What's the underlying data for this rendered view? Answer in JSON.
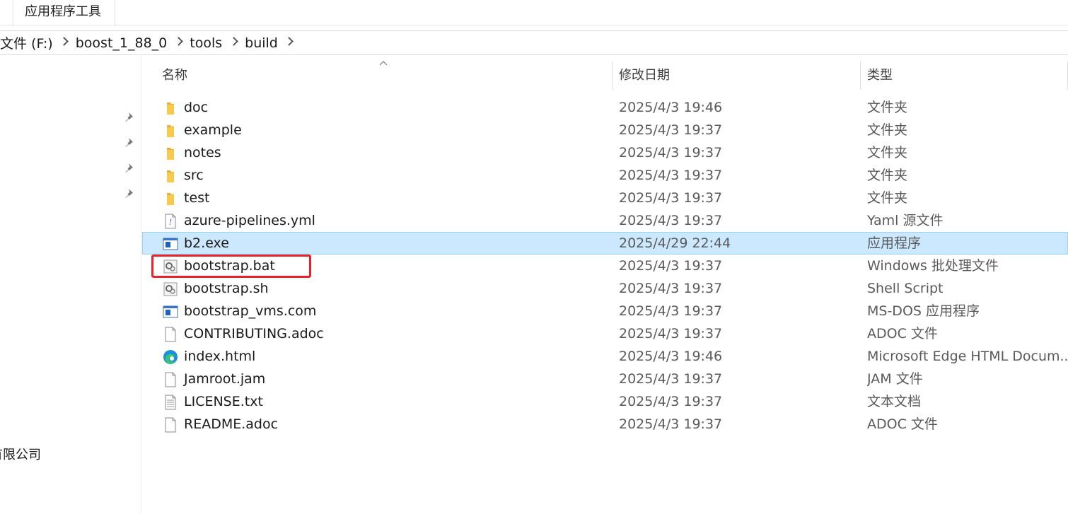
{
  "ribbon": {
    "tab_label": "应用程序工具"
  },
  "breadcrumb": [
    "文件 (F:)",
    "boost_1_88_0",
    "tools",
    "build"
  ],
  "navpane": {
    "company_label": "有限公司"
  },
  "columns": {
    "name": "名称",
    "date": "修改日期",
    "type": "类型"
  },
  "files": [
    {
      "name": "doc",
      "date": "2025/4/3 19:46",
      "type": "文件夹",
      "icon": "folder-icon"
    },
    {
      "name": "example",
      "date": "2025/4/3 19:37",
      "type": "文件夹",
      "icon": "folder-icon"
    },
    {
      "name": "notes",
      "date": "2025/4/3 19:37",
      "type": "文件夹",
      "icon": "folder-icon"
    },
    {
      "name": "src",
      "date": "2025/4/3 19:37",
      "type": "文件夹",
      "icon": "folder-icon"
    },
    {
      "name": "test",
      "date": "2025/4/3 19:37",
      "type": "文件夹",
      "icon": "folder-icon"
    },
    {
      "name": "azure-pipelines.yml",
      "date": "2025/4/3 19:37",
      "type": "Yaml 源文件",
      "icon": "yaml-file-icon"
    },
    {
      "name": "b2.exe",
      "date": "2025/4/29 22:44",
      "type": "应用程序",
      "icon": "exe-app-icon",
      "selected": true
    },
    {
      "name": "bootstrap.bat",
      "date": "2025/4/3 19:37",
      "type": "Windows 批处理文件",
      "icon": "gear-script-icon",
      "highlighted": true
    },
    {
      "name": "bootstrap.sh",
      "date": "2025/4/3 19:37",
      "type": "Shell Script",
      "icon": "gear-script-icon"
    },
    {
      "name": "bootstrap_vms.com",
      "date": "2025/4/3 19:37",
      "type": "MS-DOS 应用程序",
      "icon": "exe-app-icon"
    },
    {
      "name": "CONTRIBUTING.adoc",
      "date": "2025/4/3 19:37",
      "type": "ADOC 文件",
      "icon": "blank-file-icon"
    },
    {
      "name": "index.html",
      "date": "2025/4/3 19:46",
      "type": "Microsoft Edge HTML Docum...",
      "icon": "edge-browser-icon"
    },
    {
      "name": "Jamroot.jam",
      "date": "2025/4/3 19:37",
      "type": "JAM 文件",
      "icon": "blank-file-icon"
    },
    {
      "name": "LICENSE.txt",
      "date": "2025/4/3 19:37",
      "type": "文本文档",
      "icon": "text-file-icon"
    },
    {
      "name": "README.adoc",
      "date": "2025/4/3 19:37",
      "type": "ADOC 文件",
      "icon": "blank-file-icon"
    }
  ],
  "colors": {
    "selection_bg": "#cce8ff",
    "highlight_border": "#e8232b",
    "folder": "#f8c94a"
  }
}
